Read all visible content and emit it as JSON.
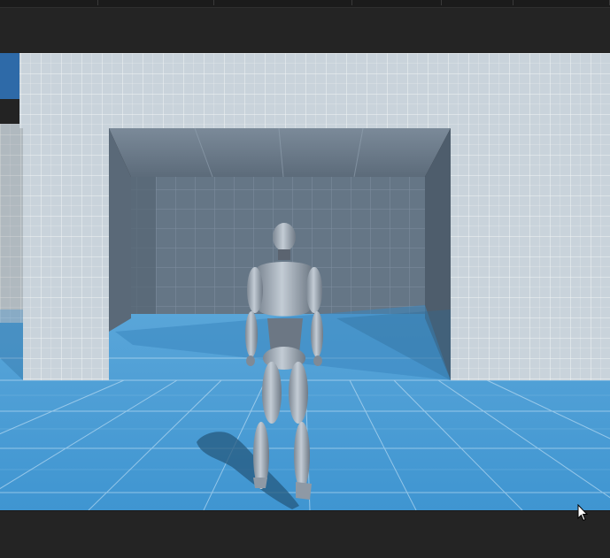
{
  "scene": {
    "background_color": "#232323",
    "wall_color": "#c8d3dc",
    "floor_color": "#4d9fd6",
    "character_color": "#9aa6b2",
    "grid_color": "#ffffff"
  },
  "icons": {
    "cursor": "mouse-pointer-icon"
  }
}
